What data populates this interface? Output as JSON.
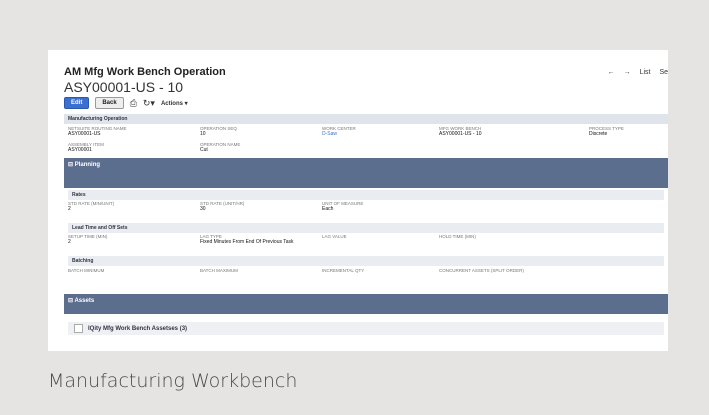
{
  "record": {
    "title": "AM Mfg Work Bench Operation",
    "record_id": "ASY00001-US - 10"
  },
  "nav": {
    "back": "←",
    "forward": "→",
    "list": "List",
    "search": "Se"
  },
  "toolbar": {
    "edit": "Edit",
    "back": "Back",
    "print_icon": "printer-icon",
    "more_icon": "refresh-icon",
    "actions": "Actions ▾"
  },
  "sections": {
    "manufacturing_operation": {
      "header": "Manufacturing Operation",
      "fields": [
        {
          "label": "NETSUITE ROUTING NAME",
          "value": "ASY00001-US"
        },
        {
          "label": "OPERATION SEQ",
          "value": "10"
        },
        {
          "label": "WORK CENTER",
          "value": "D-Saw"
        },
        {
          "label": "MFG WORK BENCH",
          "value": "ASY00001-US - 10"
        },
        {
          "label": "PROCESS TYPE",
          "value": "Discrete"
        },
        {
          "label": "ASSEMBLY ITEM",
          "value": "ASY00001"
        },
        {
          "label": "OPERATION NAME",
          "value": "Cut"
        }
      ]
    },
    "planning": {
      "header": "⊟ Planning"
    },
    "rates": {
      "header": "Rates",
      "fields": [
        {
          "label": "STD RATE (MIN/UNIT)",
          "value": "2"
        },
        {
          "label": "STD RATE (UNIT/HR)",
          "value": "30"
        },
        {
          "label": "UNIT OF MEASURE",
          "value": "Each"
        }
      ]
    },
    "lead": {
      "header": "Lead Time and Off Sets",
      "fields": [
        {
          "label": "SETUP TIME (MIN)",
          "value": "2"
        },
        {
          "label": "LAG TYPE",
          "value": "Fixed Minutes From End Of Previous Task"
        },
        {
          "label": "LAG VALUE",
          "value": ""
        },
        {
          "label": "HOLD TIME (MIN)",
          "value": ""
        }
      ]
    },
    "batching": {
      "header": "Batching",
      "fields": [
        {
          "label": "BATCH MINIMUM",
          "value": ""
        },
        {
          "label": "BATCH MAXIMUM",
          "value": ""
        },
        {
          "label": "INCREMENTAL QTY",
          "value": ""
        },
        {
          "label": "CONCURRENT ASSETS (SPLIT ORDER)",
          "value": ""
        }
      ]
    },
    "assets": {
      "header": "⊟ Assets",
      "sublist": "IQity Mfg Work Bench Assetses (3)"
    }
  },
  "caption": "Manufacturing Workbench"
}
